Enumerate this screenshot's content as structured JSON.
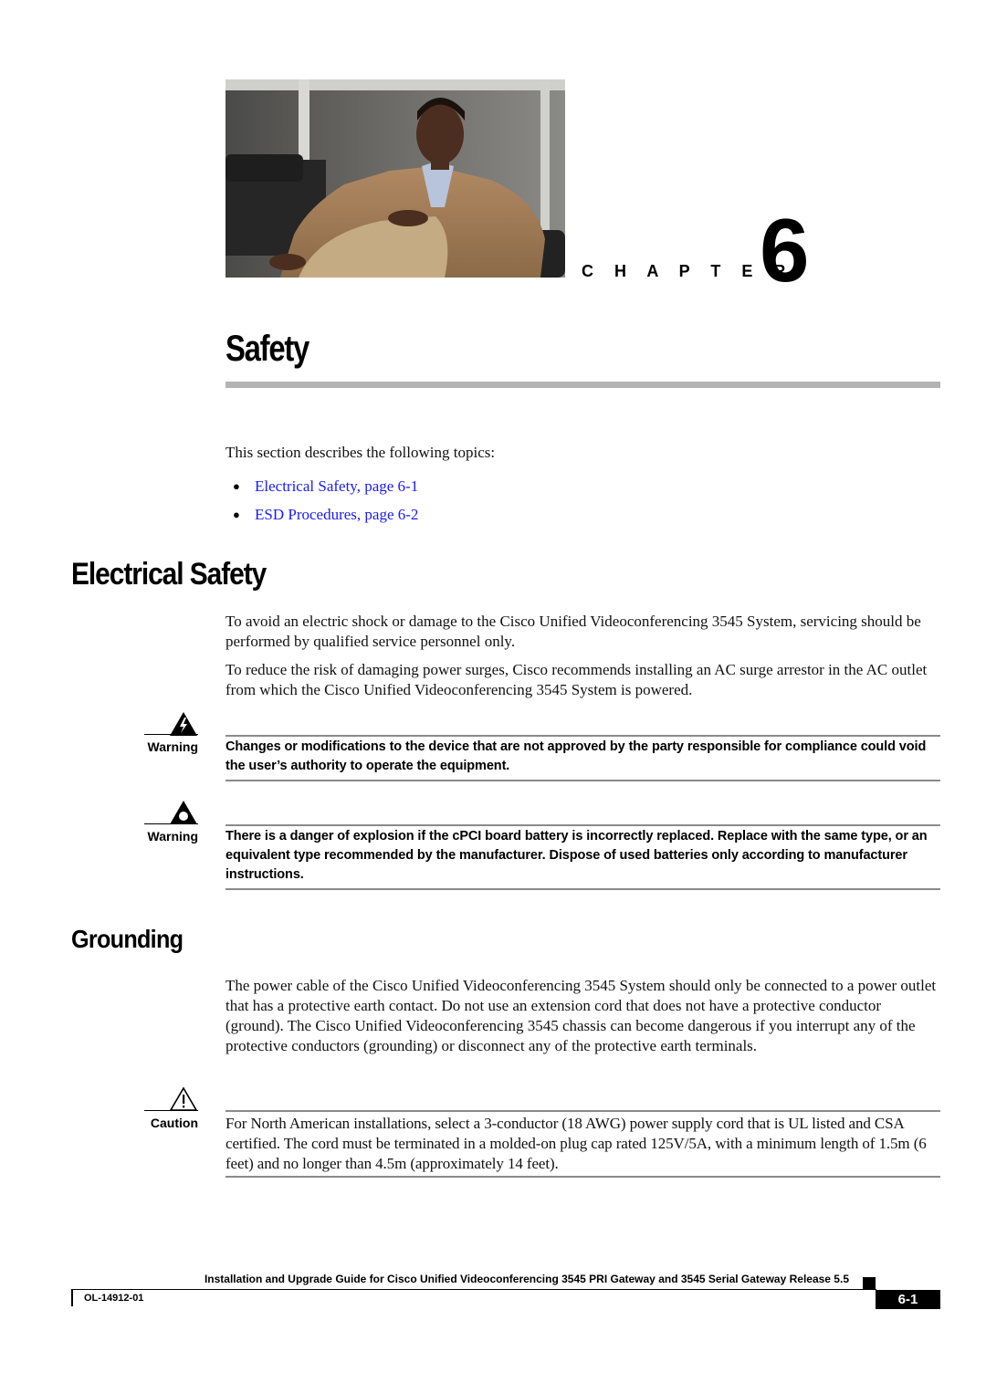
{
  "chapter": {
    "label": "C H A P T E R",
    "number": "6",
    "title": "Safety"
  },
  "photo": {
    "description": "Man in tan jacket seated in a black leather chair"
  },
  "intro": {
    "text": "This section describes the following topics:",
    "topics": [
      {
        "label": "Electrical Safety, page 6-1"
      },
      {
        "label": "ESD Procedures, page 6-2"
      }
    ]
  },
  "electrical_safety": {
    "heading": "Electrical Safety",
    "paragraphs": [
      "To avoid an electric shock or damage to the Cisco Unified Videoconferencing 3545 System, servicing should be performed by qualified service personnel only.",
      "To reduce the risk of damaging power surges, Cisco recommends installing an AC surge arrestor in the AC outlet from which the Cisco Unified Videoconferencing 3545 System is powered."
    ],
    "notes": [
      {
        "type": "Warning",
        "icon": "electrical-hazard-icon",
        "text": "Changes or modifications to the device that are not approved by the party responsible for compliance could void the user’s authority to operate the equipment."
      },
      {
        "type": "Warning",
        "icon": "explosion-hazard-icon",
        "text": "There is a danger of explosion if the cPCI board battery is incorrectly replaced. Replace with the same type, or an equivalent type recommended by the manufacturer. Dispose of used batteries only according to manufacturer instructions."
      }
    ]
  },
  "grounding": {
    "heading": "Grounding",
    "paragraph": "The power cable of the Cisco Unified Videoconferencing 3545 System should only be connected to a power outlet that has a protective earth contact. Do not use an extension cord that does not have a protective conductor (ground). The Cisco Unified Videoconferencing 3545 chassis can become dangerous if you interrupt any of the protective conductors (grounding) or disconnect any of the protective earth terminals.",
    "caution": {
      "type": "Caution",
      "icon": "caution-icon",
      "text": "For North American installations, select a 3-conductor (18 AWG) power supply cord that is UL listed and CSA certified. The cord must be terminated in a molded-on plug cap rated 125V/5A, with a minimum length of 1.5m (6 feet) and no longer than 4.5m (approximately 14 feet)."
    }
  },
  "footer": {
    "guide_title": "Installation and Upgrade Guide for Cisco Unified Videoconferencing 3545 PRI Gateway and 3545 Serial Gateway Release 5.5",
    "doc_number": "OL-14912-01",
    "page": "6-1"
  },
  "colors": {
    "link": "#1a1aff",
    "title_rule": "#b3b3b3",
    "note_rule": "#8a8a8a",
    "text": "#111111"
  }
}
